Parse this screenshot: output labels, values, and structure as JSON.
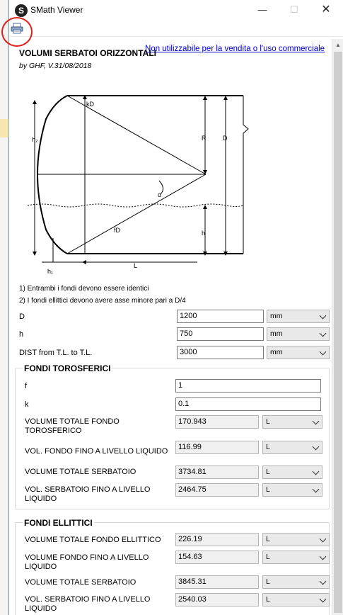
{
  "window": {
    "title": "SMath Viewer",
    "app_icon_letter": "S",
    "min_glyph": "—",
    "max_glyph": "☐",
    "close_glyph": "✕"
  },
  "toolbar": {
    "print_icon": "printer-icon",
    "commercial_notice": "Non utilizzabile per la vendita o l'uso commerciale"
  },
  "document": {
    "title": "VOLUMI SERBATOI ORIZZONTALI",
    "subtitle": "by GHF, V.31/08/2018",
    "diagram_labels": {
      "kd": "kD",
      "h2": "h₂",
      "r": "R",
      "d": "D",
      "alpha": "α",
      "fd": "fD",
      "h": "h",
      "l": "L",
      "h1": "h₁"
    },
    "notes": [
      "1) Entrambi i fondi devono essere identici",
      "2) I fondi ellittici devono avere asse minore pari a D/4"
    ]
  },
  "inputs": [
    {
      "label": "D",
      "value": "1200",
      "unit": "mm"
    },
    {
      "label": "h",
      "value": "750",
      "unit": "mm"
    },
    {
      "label": "DIST from T.L. to T.L.",
      "value": "3000",
      "unit": "mm"
    }
  ],
  "torosferici": {
    "title": "FONDI TOROSFERICI",
    "f": {
      "label": "f",
      "value": "1"
    },
    "k": {
      "label": "k",
      "value": "0.1"
    },
    "results": [
      {
        "label": "VOLUME TOTALE FONDO TOROSFERICO",
        "value": "170.943",
        "unit": "L"
      },
      {
        "label": "VOL. FONDO FINO A LIVELLO LIQUIDO",
        "value": "116.99",
        "unit": "L"
      },
      {
        "label": "VOLUME TOTALE SERBATOIO",
        "value": "3734.81",
        "unit": "L"
      },
      {
        "label": "VOL. SERBATOIO FINO A LIVELLO LIQUIDO",
        "value": "2464.75",
        "unit": "L"
      }
    ]
  },
  "ellittici": {
    "title": "FONDI ELLITTICI",
    "results": [
      {
        "label": "VOLUME TOTALE FONDO ELLITTICO",
        "value": "226.19",
        "unit": "L"
      },
      {
        "label": "VOLUME FONDO FINO A LIVELLO LIQUIDO",
        "value": "154.63",
        "unit": "L"
      },
      {
        "label": "VOLUME TOTALE SERBATOIO",
        "value": "3845.31",
        "unit": "L"
      },
      {
        "label": "VOL. SERBATOIO FINO A LIVELLO LIQUIDO",
        "value": "2540.03",
        "unit": "L"
      }
    ]
  },
  "scrollbar": {
    "up_glyph": "▲"
  },
  "colors": {
    "link": "#0000cc",
    "highlight_circle": "#e0201c"
  }
}
